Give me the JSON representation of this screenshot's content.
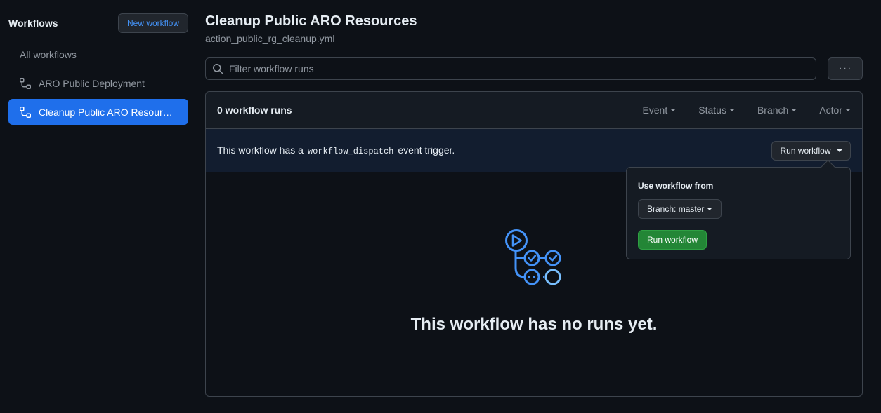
{
  "sidebar": {
    "title": "Workflows",
    "new_workflow_label": "New workflow",
    "items": [
      {
        "label": "All workflows",
        "icon": "none"
      },
      {
        "label": "ARO Public Deployment",
        "icon": "workflow-icon"
      },
      {
        "label": "Cleanup Public ARO Resources",
        "icon": "workflow-icon",
        "active": true
      }
    ]
  },
  "header": {
    "title": "Cleanup Public ARO Resources",
    "subtitle": "action_public_rg_cleanup.yml"
  },
  "search": {
    "placeholder": "Filter workflow runs",
    "value": ""
  },
  "more_button_label": "···",
  "runs": {
    "count_label": "0 workflow runs",
    "filters": [
      "Event",
      "Status",
      "Branch",
      "Actor"
    ]
  },
  "dispatch": {
    "text_before": "This workflow has a",
    "code": "workflow_dispatch",
    "text_after": "event trigger.",
    "button_label": "Run workflow"
  },
  "popover": {
    "title": "Use workflow from",
    "branch_label": "Branch: master",
    "run_label": "Run workflow"
  },
  "empty": {
    "title": "This workflow has no runs yet."
  },
  "colors": {
    "background": "#0d1117",
    "accent": "#1f6feb",
    "link": "#4493f8",
    "success": "#238636",
    "banner": "#121d2f"
  }
}
